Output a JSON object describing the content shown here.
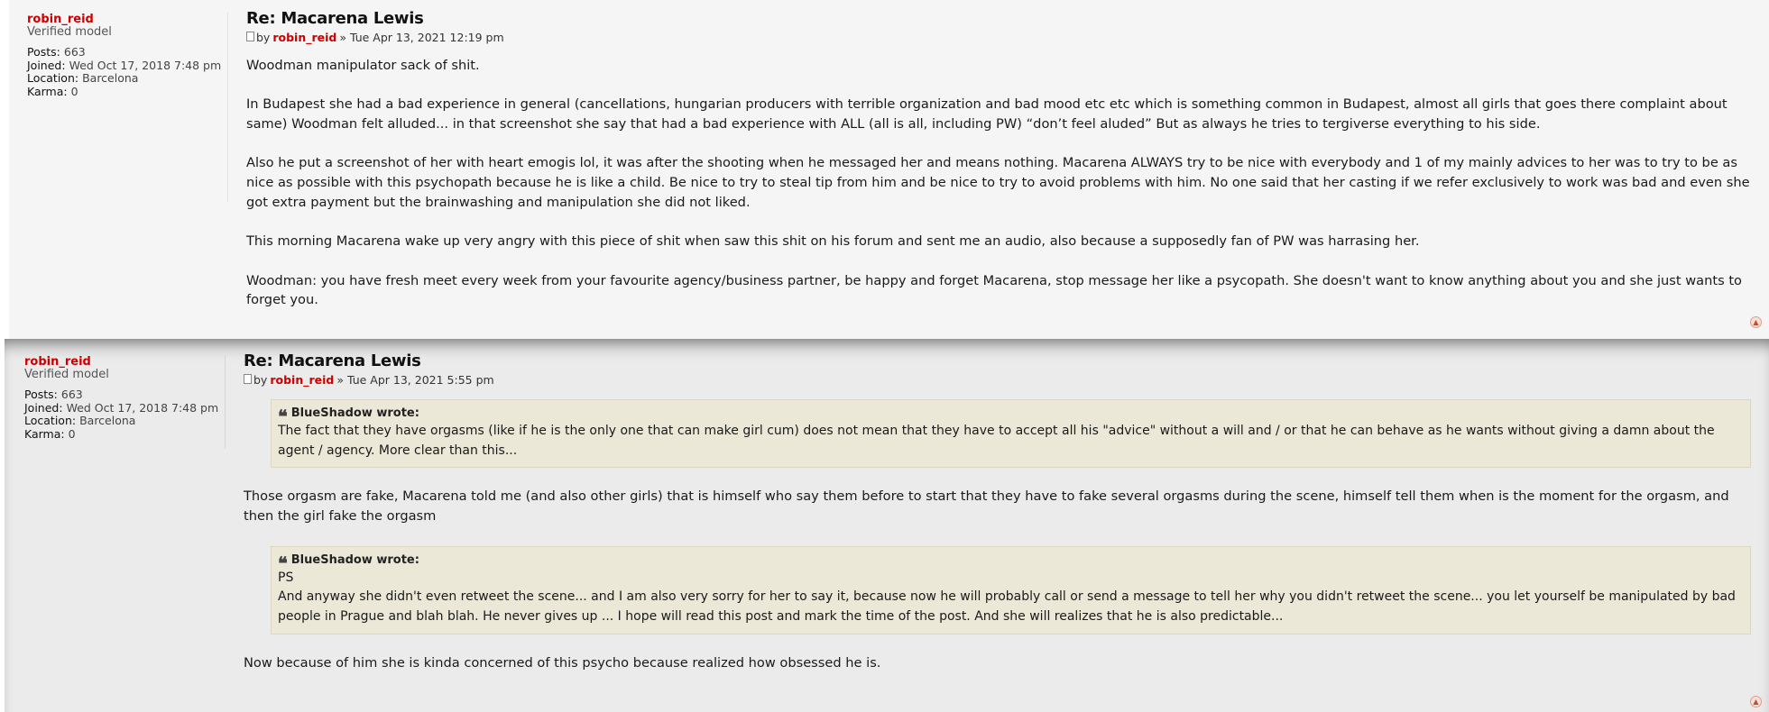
{
  "posts": [
    {
      "profile": {
        "username": "robin_reid",
        "rank": "Verified model",
        "posts_label": "Posts:",
        "posts_value": "663",
        "joined_label": "Joined:",
        "joined_value": "Wed Oct 17, 2018 7:48 pm",
        "location_label": "Location:",
        "location_value": "Barcelona",
        "karma_label": "Karma:",
        "karma_value": "0"
      },
      "title": "Re: Macarena Lewis",
      "by": "by",
      "author": "robin_reid",
      "date": "» Tue Apr 13, 2021 12:19 pm",
      "paragraphs": [
        "Woodman manipulator sack of shit.",
        "In Budapest she had a bad experience in general (cancellations, hungarian producers with terrible organization and bad mood etc etc which is something common in Budapest, almost all girls that goes there complaint about same) Woodman felt alluded... in that screenshot she say that had a bad experience with ALL (all is all, including PW) “don’t feel aluded” But as always he tries to tergiverse everything to his side.",
        "Also he put a screenshot of her with heart emogis lol, it was after the shooting when he messaged her and means nothing. Macarena ALWAYS try to be nice with everybody and 1 of my mainly advices to her was to try to be as nice as possible with this psychopath because he is like a child. Be nice to try to steal tip from him and be nice to try to avoid problems with him. No one said that her casting if we refer exclusively to work was bad and even she got extra payment but the brainwashing and manipulation she did not liked.",
        "This morning Macarena wake up very angry with this piece of shit when saw this shit on his forum and sent me an audio, also because a supposedly fan of PW was harrasing her.",
        "Woodman: you have fresh meet every week from your favourite agency/business partner, be happy and forget Macarena, stop message her like a psycopath. She doesn't want to know anything about you and she just wants to forget you."
      ]
    },
    {
      "profile": {
        "username": "robin_reid",
        "rank": "Verified model",
        "posts_label": "Posts:",
        "posts_value": "663",
        "joined_label": "Joined:",
        "joined_value": "Wed Oct 17, 2018 7:48 pm",
        "location_label": "Location:",
        "location_value": "Barcelona",
        "karma_label": "Karma:",
        "karma_value": "0"
      },
      "title": "Re: Macarena Lewis",
      "by": "by",
      "author": "robin_reid",
      "date": "» Tue Apr 13, 2021 5:55 pm",
      "quote1_header": "BlueShadow wrote:",
      "quote1_text": "The fact that they have orgasms (like if he is the only one that can make girl cum) does not mean that they have to accept all his \"advice\" without a will and / or that he can behave as he wants without giving a damn about the agent / agency. More clear than this...",
      "reply1": "Those orgasm are fake, Macarena told me (and also other girls) that is himself who say them before to start that they have to fake several orgasms during the scene, himself tell them when is the moment for the orgasm, and then the girl fake the orgasm",
      "quote2_header": "BlueShadow wrote:",
      "quote2_line1": "PS",
      "quote2_text": "And anyway she didn't even retweet the scene... and I am also very sorry for her to say it, because now he will probably call or send a message to tell her why you didn't retweet the scene... you let yourself be manipulated by bad people in Prague and blah blah. He never gives up ... I hope will read this post and mark the time of the post. And she will realizes that he is also predictable...",
      "reply2": "Now because of him she is kinda concerned of this psycho because realized how obsessed he is."
    }
  ],
  "colors": {
    "username": "#cc0000",
    "quote_bg": "#ebe8d8",
    "post1_bg": "#f5f5f5",
    "post2_bg": "#ebebeb"
  },
  "icons": [
    "post-icon",
    "quote-icon",
    "back-to-top-icon"
  ]
}
